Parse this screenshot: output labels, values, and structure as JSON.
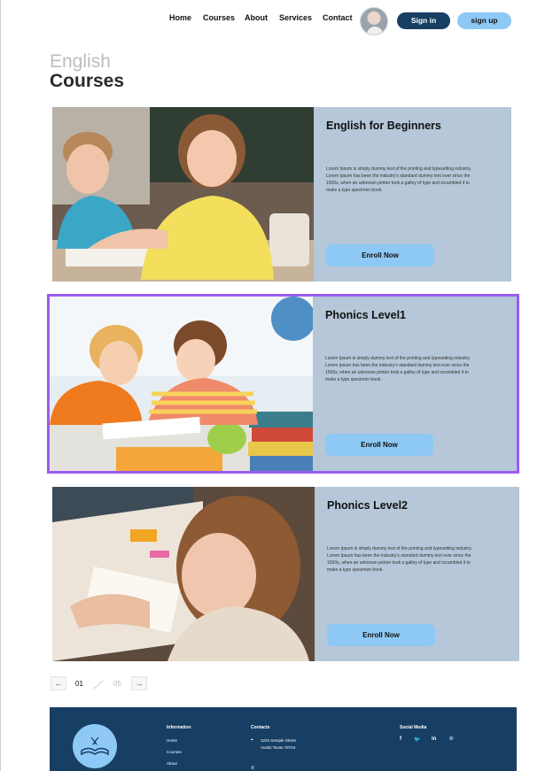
{
  "nav": {
    "links": [
      "Home",
      "Courses",
      "About",
      "Services",
      "Contact"
    ],
    "signin": "Sign in",
    "signup": "sign up"
  },
  "page": {
    "title_light": "English",
    "title_bold": "Courses"
  },
  "courses": [
    {
      "title": "English for Beginners",
      "description": "Lorem Ipsum is simply dummy text of the printing and typesetting industry. Lorem Ipsum has been the industry's standard dummy text ever since the 1500s, when an unknown printer took a galley of type and scrambled it to make a type specimen book.",
      "button": "Enroll  Now"
    },
    {
      "title": "Phonics Level1",
      "description": "Lorem Ipsum is simply dummy text of the printing and typesetting industry. Lorem Ipsum has been the industry's standard dummy text ever since the 1500s, when an unknown printer took a galley of type and scrambled it to make a type specimen book.",
      "button": "Enroll  Now"
    },
    {
      "title": "Phonics Level2",
      "description": "Lorem Ipsum is simply dummy text of the printing and typesetting industry. Lorem Ipsum has been the industry's standard dummy text ever since the 1500s, when an unknown printer took a galley of type and scrambled it to make a type specimen book.",
      "button": "Enroll  Now"
    }
  ],
  "pagination": {
    "prev": "←",
    "current": "01",
    "total": "05",
    "next": "→"
  },
  "footer": {
    "info_heading": "Information",
    "info_links": [
      "Home",
      "Courses",
      "About"
    ],
    "contacts_heading": "Contacts",
    "address_line1": "1234 Sample Street",
    "address_line2": "Austin Texas 78704",
    "social_heading": "Social Media",
    "social_icons": [
      "facebook-icon",
      "twitter-icon",
      "linkedin-icon",
      "pinterest-icon"
    ]
  },
  "colors": {
    "navy": "#173f64",
    "light_blue": "#8ec9f5",
    "card_bg": "#b5c7d8",
    "selection": "#9b5cf0"
  }
}
